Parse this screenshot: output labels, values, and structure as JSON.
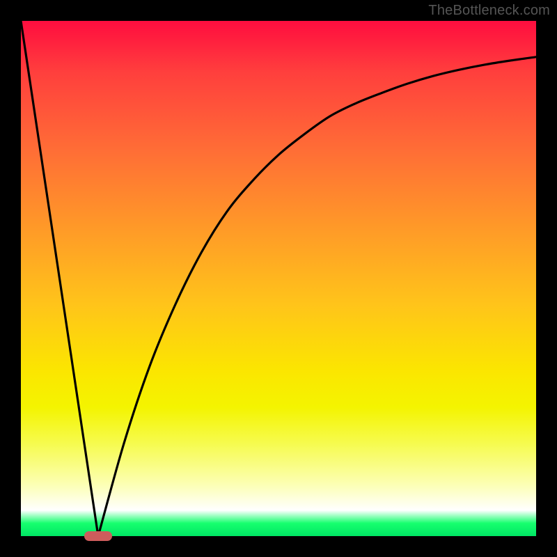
{
  "watermark": "TheBottleneck.com",
  "chart_data": {
    "type": "line",
    "title": "",
    "xlabel": "",
    "ylabel": "",
    "xlim": [
      0,
      100
    ],
    "ylim": [
      0,
      100
    ],
    "series": [
      {
        "name": "left-branch",
        "x": [
          0,
          15
        ],
        "values": [
          100,
          0
        ]
      },
      {
        "name": "right-branch",
        "x": [
          15,
          20,
          25,
          30,
          35,
          40,
          45,
          50,
          55,
          60,
          65,
          70,
          75,
          80,
          85,
          90,
          95,
          100
        ],
        "values": [
          0,
          18,
          33,
          45,
          55,
          63,
          69,
          74,
          78,
          81.5,
          84,
          86,
          87.8,
          89.3,
          90.5,
          91.5,
          92.3,
          93
        ]
      }
    ],
    "marker": {
      "x": 15,
      "y": 0
    },
    "gradient_stops": [
      {
        "pos": 0,
        "color": "#ff0d3f"
      },
      {
        "pos": 0.1,
        "color": "#ff3f3d"
      },
      {
        "pos": 0.25,
        "color": "#ff6d36"
      },
      {
        "pos": 0.4,
        "color": "#ff9928"
      },
      {
        "pos": 0.55,
        "color": "#ffc41a"
      },
      {
        "pos": 0.68,
        "color": "#fbe600"
      },
      {
        "pos": 0.75,
        "color": "#f4f400"
      },
      {
        "pos": 0.82,
        "color": "#f6fb4e"
      },
      {
        "pos": 0.9,
        "color": "#fcffb4"
      },
      {
        "pos": 0.95,
        "color": "#ffffff"
      },
      {
        "pos": 0.975,
        "color": "#16ff6e"
      },
      {
        "pos": 1.0,
        "color": "#00e664"
      }
    ]
  }
}
